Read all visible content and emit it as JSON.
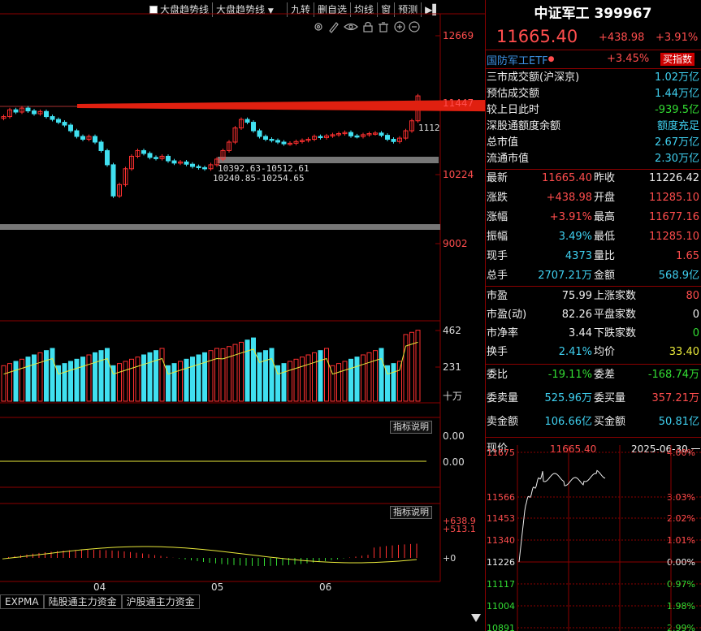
{
  "toolbar": {
    "checkbox_label": "大盘趋势线",
    "dropdown_label": "大盘趋势线",
    "items": [
      "九转",
      "删自选",
      "均线",
      "窗",
      "预测"
    ]
  },
  "main_chart": {
    "price_ticks": [
      "12669",
      "11447",
      "10224",
      "9002"
    ],
    "annot_right": "1112",
    "range1": "10392.63-10512.61",
    "range2": "10240.85-10254.65"
  },
  "volume_chart": {
    "ticks": [
      "462",
      "231",
      "十万"
    ]
  },
  "indicator1": {
    "button": "指标说明",
    "ticks": [
      "0.00",
      "0.00"
    ]
  },
  "indicator2": {
    "button": "指标说明",
    "ticks": [
      "+638.9",
      "+513.1",
      "+0"
    ]
  },
  "date_labels": [
    "04",
    "05",
    "06"
  ],
  "bottom_tabs": [
    "EXPMA",
    "陆股通主力资金",
    "沪股通主力资金"
  ],
  "quote": {
    "title": "中证军工 399967",
    "price": "11665.40",
    "change": "+438.98",
    "change_pct": "+3.91%",
    "etf_name": "国防军工ETF",
    "etf_pct": "+3.45%",
    "buy_button": "买指数",
    "stats": [
      {
        "label": "三市成交额(沪深京)",
        "value": "1.02万亿",
        "color": "cyan"
      },
      {
        "label": "预估成交额",
        "value": "1.44万亿",
        "color": "cyan"
      },
      {
        "label": "较上日此时",
        "value": "-939.5亿",
        "color": "green"
      },
      {
        "label": "深股通额度余额",
        "value": "额度充足",
        "color": "cyan"
      },
      {
        "label": "总市值",
        "value": "2.67万亿",
        "color": "cyan"
      },
      {
        "label": "流通市值",
        "value": "2.30万亿",
        "color": "cyan"
      }
    ],
    "grid": [
      {
        "l1": "最新",
        "v1": "11665.40",
        "c1": "red",
        "l2": "昨收",
        "v2": "11226.42",
        "c2": "white"
      },
      {
        "l1": "涨跌",
        "v1": "+438.98",
        "c1": "red",
        "l2": "开盘",
        "v2": "11285.10",
        "c2": "red"
      },
      {
        "l1": "涨幅",
        "v1": "+3.91%",
        "c1": "red",
        "l2": "最高",
        "v2": "11677.16",
        "c2": "red"
      },
      {
        "l1": "振幅",
        "v1": "3.49%",
        "c1": "cyan",
        "l2": "最低",
        "v2": "11285.10",
        "c2": "red"
      },
      {
        "l1": "现手",
        "v1": "4373",
        "c1": "cyan",
        "l2": "量比",
        "v2": "1.65",
        "c2": "red"
      },
      {
        "l1": "总手",
        "v1": "2707.21万",
        "c1": "cyan",
        "l2": "金额",
        "v2": "568.9亿",
        "c2": "cyan"
      }
    ],
    "grid2": [
      {
        "l1": "市盈",
        "v1": "75.99",
        "c1": "white",
        "l2": "上涨家数",
        "v2": "80",
        "c2": "red"
      },
      {
        "l1": "市盈(动)",
        "v1": "82.26",
        "c1": "white",
        "l2": "平盘家数",
        "v2": "0",
        "c2": "white"
      },
      {
        "l1": "市净率",
        "v1": "3.44",
        "c1": "white",
        "l2": "下跌家数",
        "v2": "0",
        "c2": "green"
      },
      {
        "l1": "换手",
        "v1": "2.41%",
        "c1": "cyan",
        "l2": "均价",
        "v2": "33.40",
        "c2": "yellow"
      }
    ],
    "wb": {
      "l1": "委比",
      "v1": "-19.11%",
      "c1": "green",
      "l2": "委差",
      "v2": "-168.74万",
      "c2": "green"
    },
    "wm": {
      "l1": "委卖量",
      "v1": "525.96万",
      "c1": "cyan",
      "l2": "委买量",
      "v2": "357.21万",
      "c2": "red"
    },
    "mj": {
      "l1": "卖金额",
      "v1": "106.66亿",
      "c1": "cyan",
      "l2": "买金额",
      "v2": "50.81亿",
      "c2": "cyan"
    }
  },
  "intraday": {
    "label": "现价",
    "price": "11665.40",
    "date": "2025-06-30,一",
    "left_ticks": [
      "11675",
      "11566",
      "11453",
      "11340",
      "11226",
      "11117",
      "11004",
      "10891"
    ],
    "right_ticks": [
      "4.00%",
      "3.03%",
      "2.02%",
      "1.01%",
      "0.00%",
      "0.97%",
      "1.98%",
      "2.99%"
    ]
  },
  "colors": {
    "up": "#ff3030",
    "down": "#40e0f0",
    "grid": "#8b0000",
    "bg": "#000000"
  }
}
